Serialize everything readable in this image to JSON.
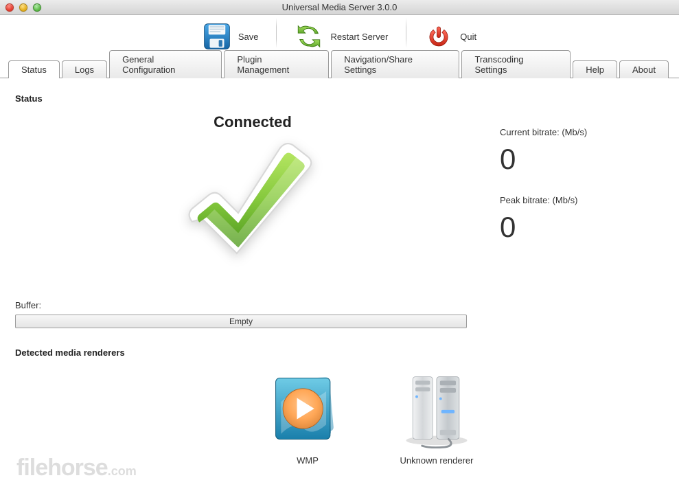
{
  "window": {
    "title": "Universal Media Server 3.0.0"
  },
  "toolbar": {
    "save_label": "Save",
    "restart_label": "Restart Server",
    "quit_label": "Quit"
  },
  "tabs": [
    {
      "label": "Status",
      "active": true
    },
    {
      "label": "Logs",
      "active": false
    },
    {
      "label": "General Configuration",
      "active": false
    },
    {
      "label": "Plugin Management",
      "active": false
    },
    {
      "label": "Navigation/Share Settings",
      "active": false
    },
    {
      "label": "Transcoding Settings",
      "active": false
    },
    {
      "label": "Help",
      "active": false
    },
    {
      "label": "About",
      "active": false
    }
  ],
  "status": {
    "section_title": "Status",
    "connected_label": "Connected",
    "current_bitrate_label": "Current bitrate: (Mb/s)",
    "current_bitrate_value": "0",
    "peak_bitrate_label": "Peak bitrate: (Mb/s)",
    "peak_bitrate_value": "0",
    "buffer_label": "Buffer:",
    "buffer_status": "Empty"
  },
  "renderers": {
    "section_title": "Detected media renderers",
    "items": [
      {
        "name": "WMP",
        "icon": "wmp-icon"
      },
      {
        "name": "Unknown renderer",
        "icon": "server-icon"
      }
    ]
  },
  "watermark": {
    "text_main": "filehorse",
    "text_suffix": ".com"
  }
}
